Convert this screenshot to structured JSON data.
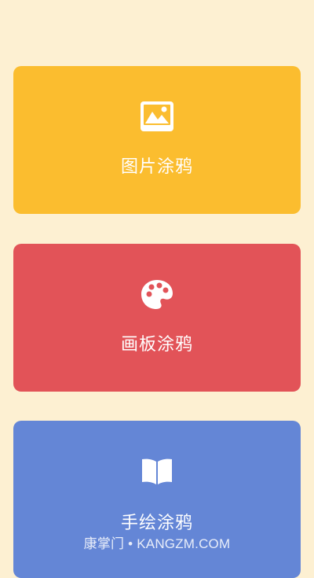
{
  "cards": [
    {
      "label": "图片涂鸦",
      "icon": "image-icon",
      "color": "#fbbd2f"
    },
    {
      "label": "画板涂鸦",
      "icon": "palette-icon",
      "color": "#e25358"
    },
    {
      "label": "手绘涂鸦",
      "icon": "book-icon",
      "color": "#6486d6"
    }
  ],
  "watermark": "康掌门 • KANGZM.COM",
  "colors": {
    "background": "#fdf0d2"
  }
}
